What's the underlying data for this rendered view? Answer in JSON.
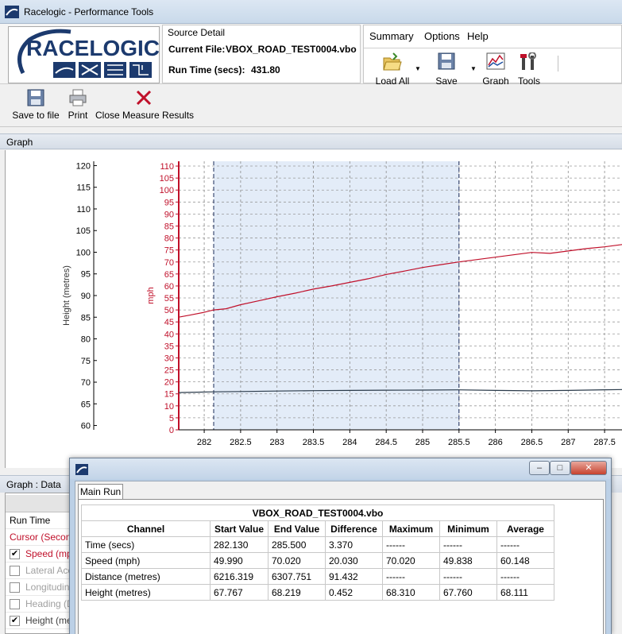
{
  "window": {
    "title": "Racelogic - Performance Tools"
  },
  "logo": {
    "text": "RACELOGIC"
  },
  "source_detail": {
    "caption": "Source Detail",
    "current_file_label": "Current File:",
    "current_file": "VBOX_ROAD_TEST0004.vbo",
    "run_time_label": "Run Time (secs):",
    "run_time": "431.80"
  },
  "menu": {
    "items": [
      "Summary",
      "Options",
      "Help"
    ]
  },
  "ribbon_buttons": [
    {
      "label": "Load All",
      "icon": "folder-open-icon"
    },
    {
      "label": "Save",
      "icon": "floppy-disk-icon"
    },
    {
      "label": "Graph",
      "icon": "graph-icon"
    },
    {
      "label": "Tools",
      "icon": "tools-icon"
    }
  ],
  "toolbar2": {
    "save_to_file": "Save to file",
    "print": "Print",
    "close_measure": "Close Measure Results"
  },
  "graph_panel": {
    "title": "Graph"
  },
  "chart_data": {
    "type": "line",
    "x_ticks": [
      "282",
      "282.5",
      "283",
      "283.5",
      "284",
      "284.5",
      "285",
      "285.5",
      "286",
      "286.5",
      "287",
      "287.5"
    ],
    "xlim": [
      281.65,
      287.75
    ],
    "left_axis": {
      "label": "Height (metres)",
      "ylim": [
        59,
        121
      ],
      "ticks": [
        "60",
        "65",
        "70",
        "75",
        "80",
        "85",
        "90",
        "95",
        "100",
        "105",
        "110",
        "115",
        "120"
      ]
    },
    "right_axis": {
      "label": "mph",
      "ylim": [
        0,
        112
      ],
      "ticks": [
        "0",
        "5",
        "10",
        "15",
        "20",
        "25",
        "30",
        "35",
        "40",
        "45",
        "50",
        "55",
        "60",
        "65",
        "70",
        "75",
        "80",
        "85",
        "90",
        "95",
        "100",
        "105",
        "110"
      ]
    },
    "selection": {
      "x_start": 282.13,
      "x_end": 285.5
    },
    "series": [
      {
        "color": "#c0102a",
        "axis": "right",
        "x": [
          281.65,
          281.8,
          282.0,
          282.13,
          282.3,
          282.5,
          282.75,
          283.0,
          283.25,
          283.5,
          283.75,
          284.0,
          284.25,
          284.5,
          284.75,
          285.0,
          285.25,
          285.5,
          285.75,
          286.0,
          286.25,
          286.5,
          286.75,
          287.0,
          287.25,
          287.5,
          287.75
        ],
        "y": [
          47.0,
          47.8,
          49.0,
          49.99,
          50.5,
          52.2,
          53.8,
          55.5,
          57.0,
          58.7,
          60.0,
          61.5,
          63.0,
          64.8,
          66.2,
          67.7,
          68.9,
          70.02,
          71.0,
          72.0,
          73.0,
          74.0,
          73.6,
          74.6,
          75.6,
          76.3,
          77.3
        ]
      },
      {
        "color": "#2a3a4a",
        "axis": "left",
        "x": [
          281.65,
          282.13,
          282.5,
          283.0,
          283.5,
          284.0,
          284.5,
          285.0,
          285.5,
          286.0,
          286.5,
          287.0,
          287.5,
          287.75
        ],
        "y": [
          67.6,
          67.77,
          67.85,
          67.95,
          68.05,
          68.1,
          68.15,
          68.18,
          68.22,
          68.1,
          68.0,
          68.1,
          68.25,
          68.3
        ]
      }
    ]
  },
  "data_panel": {
    "title": "Graph : Data",
    "rows": [
      {
        "label": "Run Time",
        "checkbox": "none",
        "color": "#000000"
      },
      {
        "label": "Cursor (Seconds)",
        "checkbox": "none",
        "color": "#c0102a"
      },
      {
        "label": "Speed (mph)",
        "checkbox": "checked",
        "color": "#c0102a"
      },
      {
        "label": "Lateral Acc",
        "checkbox": "unchecked",
        "color": "#a0a0a0"
      },
      {
        "label": "Longitudinal",
        "checkbox": "unchecked",
        "color": "#a0a0a0"
      },
      {
        "label": "Heading (D",
        "checkbox": "unchecked",
        "color": "#a0a0a0"
      },
      {
        "label": "Height (metres)",
        "checkbox": "checked",
        "color": "#404040"
      }
    ]
  },
  "popup": {
    "tab": "Main Run",
    "file_caption": "VBOX_ROAD_TEST0004.vbo",
    "headers": [
      "Channel",
      "Start Value",
      "End Value",
      "Difference",
      "Maximum",
      "Minimum",
      "Average"
    ],
    "rows": [
      [
        "Time (secs)",
        "282.130",
        "285.500",
        "3.370",
        "------",
        "------",
        "------"
      ],
      [
        "Speed (mph)",
        "49.990",
        "70.020",
        "20.030",
        "70.020",
        "49.838",
        "60.148"
      ],
      [
        "Distance (metres)",
        "6216.319",
        "6307.751",
        "91.432",
        "------",
        "------",
        "------"
      ],
      [
        "Height (metres)",
        "67.767",
        "68.219",
        "0.452",
        "68.310",
        "67.760",
        "68.111"
      ]
    ]
  }
}
